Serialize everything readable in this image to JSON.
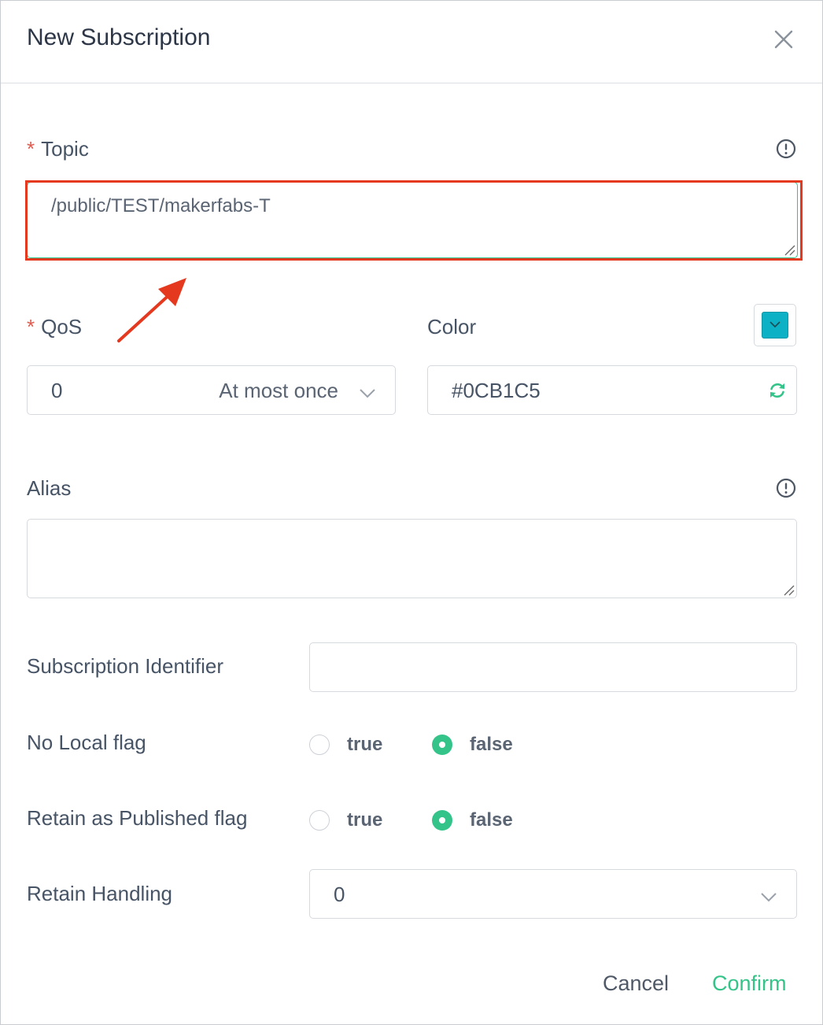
{
  "dialog": {
    "title": "New Subscription"
  },
  "topic": {
    "required_mark": "*",
    "label": "Topic",
    "value": "/public/TEST/makerfabs-T"
  },
  "qos": {
    "required_mark": "*",
    "label": "QoS",
    "value": "0",
    "description": "At most once"
  },
  "color": {
    "label": "Color",
    "value": "#0CB1C5",
    "swatch": "#0CB1C5"
  },
  "alias": {
    "label": "Alias",
    "value": ""
  },
  "subscription_identifier": {
    "label": "Subscription Identifier",
    "value": ""
  },
  "no_local": {
    "label": "No Local flag",
    "options": [
      "true",
      "false"
    ],
    "selected": "false"
  },
  "retain_as_published": {
    "label": "Retain as Published flag",
    "options": [
      "true",
      "false"
    ],
    "selected": "false"
  },
  "retain_handling": {
    "label": "Retain Handling",
    "value": "0"
  },
  "footer": {
    "cancel_label": "Cancel",
    "confirm_label": "Confirm"
  },
  "colors": {
    "accent_green": "#34c388",
    "annotation_red": "#e5391f",
    "required_red": "#e05a4e"
  },
  "icons": {
    "close": "close-icon",
    "info": "info-icon",
    "chevron": "chevron-down-icon",
    "refresh": "refresh-icon"
  }
}
